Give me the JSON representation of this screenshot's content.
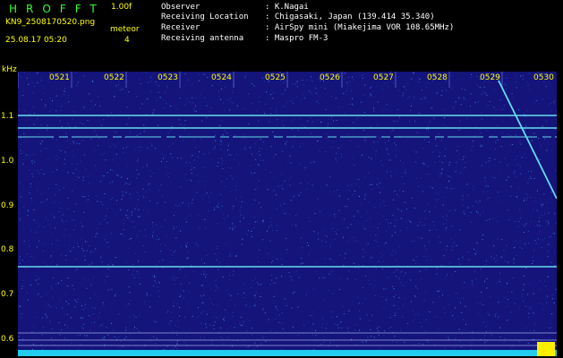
{
  "header": {
    "app_title": "HROFFT",
    "version": "1.00f",
    "filename": "KN9_2508170520.png",
    "datetime": "25.08.17 05:20",
    "mode_label": "meteor",
    "mode_count": "4"
  },
  "info": [
    {
      "label": "Observer",
      "value": ": K.Nagai"
    },
    {
      "label": "Receiving Location",
      "value": ": Chigasaki, Japan (139.414 35.340)"
    },
    {
      "label": "Receiver",
      "value": ": AirSpy mini (Miakejima VOR 108.65MHz)"
    },
    {
      "label": "Receiving antenna",
      "value": ": Maspro FM-3"
    }
  ],
  "axis": {
    "y_unit": "kHz",
    "y_ticks": [
      "1.1",
      "1.0",
      "0.9",
      "0.8",
      "0.7",
      "0.6"
    ],
    "x_ticks": [
      "0521",
      "0522",
      "0523",
      "0524",
      "0525",
      "0526",
      "0527",
      "0528",
      "0529",
      "0530"
    ]
  },
  "colors": {
    "background": "#14147a",
    "label": "#ffff00",
    "title": "#33ff33",
    "trace": "#66ddee"
  }
}
